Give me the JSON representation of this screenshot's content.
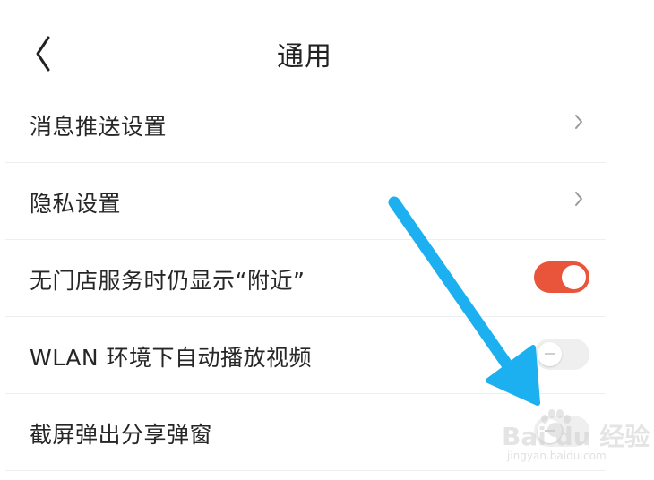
{
  "header": {
    "title": "通用",
    "back_icon": "chevron-left-icon"
  },
  "settings": [
    {
      "label": "消息推送设置",
      "control": "chevron",
      "icon": "chevron-right-icon"
    },
    {
      "label": "隐私设置",
      "control": "chevron",
      "icon": "chevron-right-icon"
    },
    {
      "label": "无门店服务时仍显示“附近”",
      "control": "toggle",
      "state": "on"
    },
    {
      "label": "WLAN 环境下自动播放视频",
      "control": "toggle",
      "state": "off"
    },
    {
      "label": "截屏弹出分享弹窗",
      "control": "toggle",
      "state": "off"
    }
  ],
  "annotation": {
    "icon": "blue-arrow-icon",
    "color": "#1cb0f0"
  },
  "watermark": {
    "main": "Bai du 经验",
    "sub": "jingyan.baidu.com"
  },
  "colors": {
    "toggle_on": "#e8553a",
    "toggle_off": "#efefef",
    "divider": "#eeeeee",
    "text": "#262626"
  }
}
